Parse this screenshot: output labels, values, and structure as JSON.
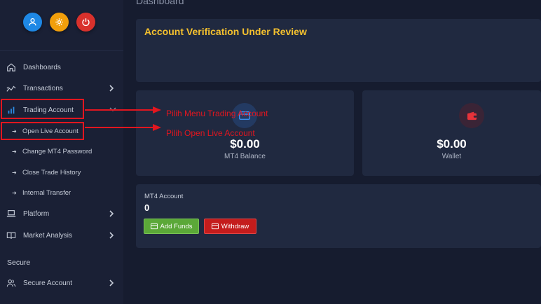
{
  "header": {
    "title": "Dashboard"
  },
  "sidebar": {
    "top_buttons": [
      {
        "icon": "user-icon",
        "color": "#1e88e5"
      },
      {
        "icon": "gear-icon",
        "color": "#f29f0b"
      },
      {
        "icon": "power-icon",
        "color": "#d9312c"
      }
    ],
    "items": [
      {
        "label": "Dashboards",
        "icon": "home-icon"
      },
      {
        "label": "Transactions",
        "icon": "trend-icon"
      },
      {
        "label": "Trading Account",
        "icon": "bar-chart-icon"
      },
      {
        "label": "Platform",
        "icon": "laptop-icon"
      },
      {
        "label": "Market Analysis",
        "icon": "book-icon"
      },
      {
        "label": "Secure Account",
        "icon": "users-icon"
      }
    ],
    "sub_items": [
      {
        "label": "Open Live Account"
      },
      {
        "label": "Change MT4 Password"
      },
      {
        "label": "Close Trade History"
      },
      {
        "label": "Internal Transfer"
      }
    ],
    "section_secure": "Secure"
  },
  "verification": {
    "title": "Account Verification Under Review"
  },
  "stats": {
    "mt4_balance": {
      "value": "$0.00",
      "label": "MT4 Balance"
    },
    "wallet": {
      "value": "$0.00",
      "label": "Wallet"
    }
  },
  "mt4_account": {
    "label": "MT4 Account",
    "value": "0",
    "add_funds_label": "Add Funds",
    "withdraw_label": "Withdraw"
  },
  "annotations": {
    "step1": "Pilih Menu Trading Account",
    "step2": "Pilih  Open Live Account"
  },
  "colors": {
    "accent_yellow": "#f5c12e",
    "annotation_red": "#e2161f",
    "green_button": "#5ba838",
    "red_button": "#c41c1c"
  }
}
